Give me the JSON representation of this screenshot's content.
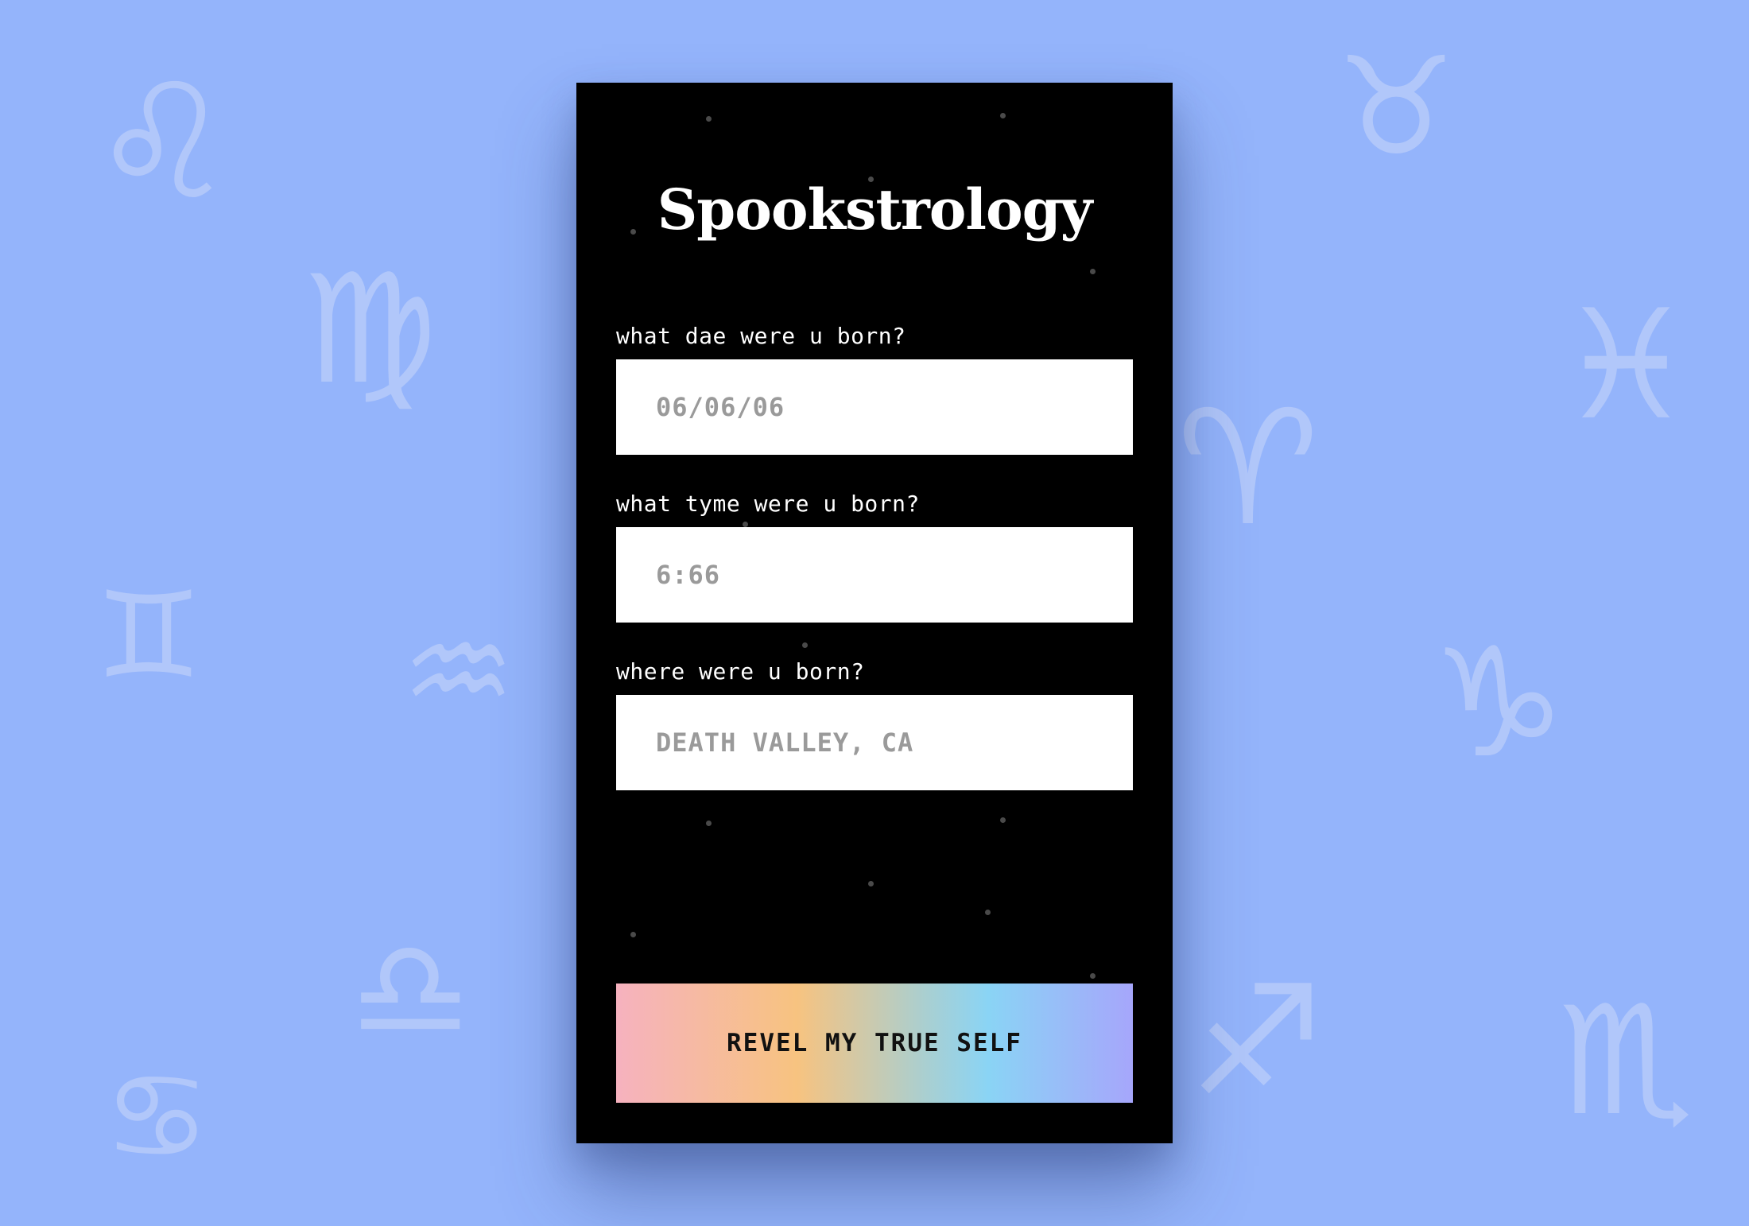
{
  "background": {
    "color": "#94b4fb",
    "symbols": [
      {
        "name": "leo-icon",
        "glyph": "♌"
      },
      {
        "name": "virgo-icon",
        "glyph": "♍"
      },
      {
        "name": "gemini-icon",
        "glyph": "♊"
      },
      {
        "name": "aquarius-icon",
        "glyph": "♒"
      },
      {
        "name": "libra-icon",
        "glyph": "♎"
      },
      {
        "name": "cancer-icon",
        "glyph": "♋"
      },
      {
        "name": "taurus-icon",
        "glyph": "♉"
      },
      {
        "name": "pisces-icon",
        "glyph": "♓"
      },
      {
        "name": "aries-icon",
        "glyph": "♈"
      },
      {
        "name": "capricorn-icon",
        "glyph": "♑"
      },
      {
        "name": "sagittarius-icon",
        "glyph": "♐"
      },
      {
        "name": "scorpio-icon",
        "glyph": "♏"
      }
    ]
  },
  "app": {
    "title": "Spookstrology"
  },
  "form": {
    "date": {
      "label": "what dae were u born?",
      "placeholder": "06/06/06"
    },
    "time": {
      "label": "what tyme were u born?",
      "placeholder": "6:66"
    },
    "place": {
      "label": "where were u born?",
      "placeholder": "DEATH VALLEY, CA"
    },
    "submit_label": "REVEL MY TRUE SELF"
  },
  "colors": {
    "card": "#000000",
    "input_text": "#9a9a9a",
    "gradient": [
      "#f6b2bf",
      "#f7c380",
      "#8ad4f5",
      "#a6a6fb"
    ]
  }
}
